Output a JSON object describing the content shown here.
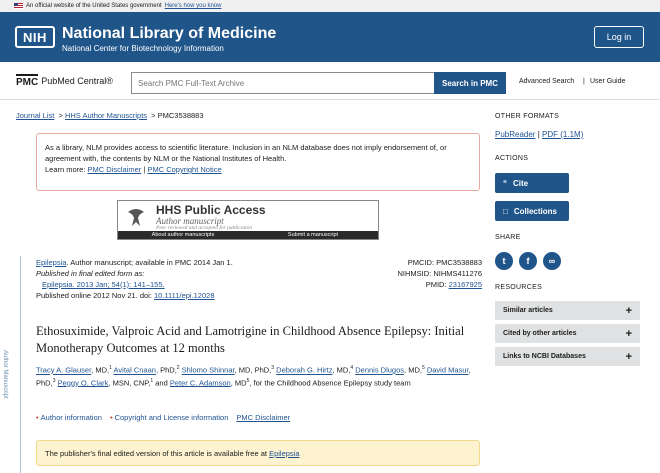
{
  "gov_banner": {
    "text": "An official website of the United States government",
    "link": "Here's how you know"
  },
  "header": {
    "logo": "NIH",
    "title": "National Library of Medicine",
    "subtitle": "National Center for Biotechnology Information",
    "login": "Log in"
  },
  "pmcbar": {
    "logo_mark": "PMC",
    "logo_name": "PubMed Central®",
    "search_placeholder": "Search PMC Full-Text Archive",
    "search_button": "Search in PMC",
    "advanced": "Advanced Search",
    "sep": "|",
    "guide": "User Guide"
  },
  "breadcrumb": {
    "item1": "Journal List",
    "sep1": ">",
    "item2": "HHS Author Manuscripts",
    "sep2": ">",
    "current": "PMC3538883"
  },
  "notice": {
    "text": "As a library, NLM provides access to scientific literature. Inclusion in an NLM database does not imply endorsement of, or agreement with, the contents by NLM or the National Institutes of Health.",
    "learn": "Learn more:",
    "link1": "PMC Disclaimer",
    "sep": "|",
    "link2": "PMC Copyright Notice"
  },
  "hhs": {
    "title": "HHS Public Access",
    "subtitle": "Author manuscript",
    "note": "Peer reviewed and accepted for publication",
    "left_link": "About author manuscripts",
    "right_link": "Submit a manuscript"
  },
  "side_label": "Author Manuscript",
  "citation": {
    "journal": "Epilepsia",
    "line1_rest": ". Author manuscript; available in PMC 2014 Jan 1.",
    "line2": "Published in final edited form as:",
    "line3": "Epilepsia. 2013 Jan; 54(1): 141–155.",
    "line4_pre": "Published online 2012 Nov 21. doi: ",
    "doi": "10.1111/epi.12028"
  },
  "ids": {
    "pmcid": "PMCID: PMC3538883",
    "nihmsid": "NIHMSID: NIHMS411276",
    "pmid_label": "PMID: ",
    "pmid": "23167925"
  },
  "title": "Ethosuximide, Valproic Acid and Lamotrigine in Childhood Absence Epilepsy: Initial Monotherapy Outcomes at 12 months",
  "authors": [
    {
      "name": "Tracy A. Glauser",
      "suffix": ", MD,",
      "sup": "1"
    },
    {
      "name": "Avital Cnaan",
      "suffix": ", PhD,",
      "sup": "2"
    },
    {
      "name": "Shlomo Shinnar",
      "suffix": ", MD, PhD,",
      "sup": "3"
    },
    {
      "name": "Deborah G. Hirtz",
      "suffix": ", MD,",
      "sup": "4"
    },
    {
      "name": "Dennis Dlugos",
      "suffix": ", MD,",
      "sup": "5"
    },
    {
      "name": "David Masur",
      "suffix": ", PhD,",
      "sup": "3"
    },
    {
      "name": "Peggy O. Clark",
      "suffix": ", MSN, CNP,",
      "sup": "1"
    },
    {
      "name": "Peter C. Adamson",
      "suffix": ", MD",
      "sup": "5"
    }
  ],
  "authors_and": "and",
  "authors_tail": ", for the Childhood Absence Epilepsy study team",
  "links": {
    "author_info": "Author information",
    "copyright": "Copyright and License information",
    "disclaimer": "PMC Disclaimer",
    "dot": "•"
  },
  "final_box": {
    "text": "The publisher's final edited version of this article is available free at ",
    "link": "Epilepsia"
  },
  "sidebar": {
    "other_formats": "OTHER FORMATS",
    "pubreader": "PubReader",
    "pipe": "|",
    "pdf": "PDF (1.1M)",
    "actions": "ACTIONS",
    "cite": "Cite",
    "collections": "Collections",
    "share": "SHARE",
    "resources": "RESOURCES",
    "similar": "Similar articles",
    "cited_by": "Cited by other articles",
    "ncbi": "Links to NCBI Databases"
  },
  "colors": {
    "primary": "#20558a",
    "link": "#205493",
    "notice_border": "#e8a9a2",
    "final_bg": "#fdf3d1"
  },
  "icons": {
    "cite": "quote-icon",
    "collections": "bookmark-icon",
    "twitter": "twitter-icon",
    "facebook": "facebook-icon",
    "link": "link-icon",
    "plus": "plus-icon"
  }
}
